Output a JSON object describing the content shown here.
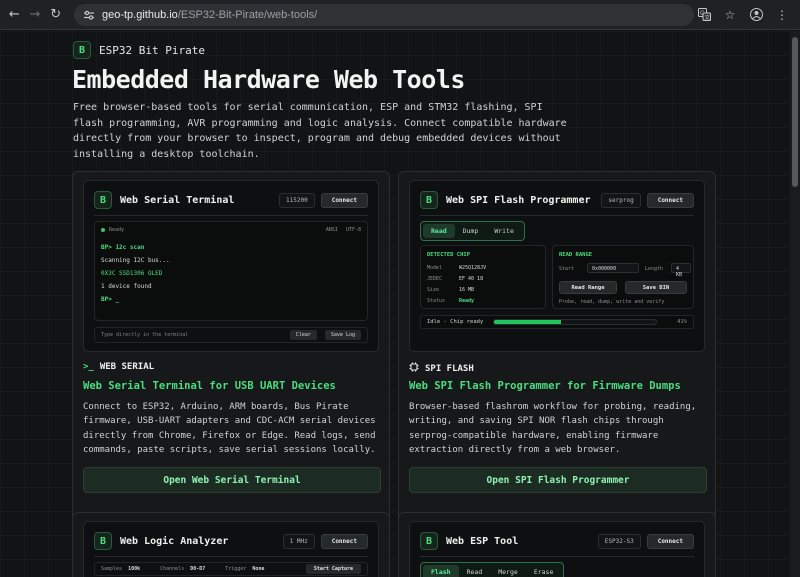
{
  "browser": {
    "url_host": "geo-tp.github.io",
    "url_path": "/ESP32-Bit-Pirate/web-tools/"
  },
  "page": {
    "brand_logo": "B",
    "brand_name": "ESP32 Bit Pirate",
    "title": "Embedded Hardware Web Tools",
    "description": "Free browser-based tools for serial communication, ESP and STM32 flashing, SPI flash programming, AVR programming and logic analysis. Connect compatible hardware directly from your browser to inspect, program and debug embedded devices without installing a desktop toolchain."
  },
  "colors": {
    "accent": "#4ade80",
    "background": "#121315",
    "card": "#161819"
  },
  "cards": {
    "serial": {
      "preview_title": "Web Serial Terminal",
      "badge": "115200",
      "connect": "Connect",
      "status": "Ready",
      "meta_left": "ANSI",
      "meta_right": "UTF-8",
      "lines": [
        "BP> i2c scan",
        "Scanning I2C bus...",
        "0X3C SSD1306 OLED",
        "1 device found",
        "BP> _"
      ],
      "input_placeholder": "Type directly in the terminal",
      "clear": "Clear",
      "save_log": "Save Log",
      "category_icon": "terminal-icon",
      "category": "WEB SERIAL",
      "title": "Web Serial Terminal for USB UART Devices",
      "description": "Connect to ESP32, Arduino, ARM boards, Bus Pirate firmware, USB-UART adapters and CDC-ACM serial devices directly from Chrome, Firefox or Edge. Read logs, send commands, paste scripts, save serial sessions locally.",
      "cta": "Open Web Serial Terminal"
    },
    "spi": {
      "preview_title": "Web SPI Flash Programmer",
      "badge": "serprog",
      "connect": "Connect",
      "tabs": [
        "Read",
        "Dump",
        "Write"
      ],
      "detected_heading": "DETECTED CHIP",
      "chip": [
        {
          "k": "Model",
          "v": "W25Q128JV"
        },
        {
          "k": "JEDEC",
          "v": "EF 40 18"
        },
        {
          "k": "Size",
          "v": "16 MB"
        },
        {
          "k": "Status",
          "v": "Ready"
        }
      ],
      "range_heading": "READ RANGE",
      "start_label": "Start",
      "start_value": "0x000000",
      "length_label": "Length",
      "length_value": "4 KB",
      "read_range": "Read Range",
      "save_bin": "Save BIN",
      "note": "Probe, read, dump, write and verify",
      "progress_label": "Idle - Chip ready",
      "progress_value": 41,
      "progress_text": "41%",
      "category_icon": "chip-icon",
      "category": "SPI FLASH",
      "title": "Web SPI Flash Programmer for Firmware Dumps",
      "description": "Browser-based flashrom workflow for probing, reading, writing, and saving SPI NOR flash chips through serprog-compatible hardware, enabling firmware extraction directly from a web browser.",
      "cta": "Open SPI Flash Programmer"
    },
    "logic": {
      "preview_title": "Web Logic Analyzer",
      "badge": "1 MHz",
      "connect": "Connect",
      "samples_label": "Samples",
      "samples_value": "100k",
      "channels_label": "Channels",
      "channels_value": "D0-D7",
      "trigger_label": "Trigger",
      "trigger_value": "None",
      "start_capture": "Start Capture"
    },
    "esp": {
      "preview_title": "Web ESP Tool",
      "badge": "ESP32-S3",
      "connect": "Connect",
      "tabs": [
        "Flash",
        "Read",
        "Merge",
        "Erase"
      ]
    }
  }
}
